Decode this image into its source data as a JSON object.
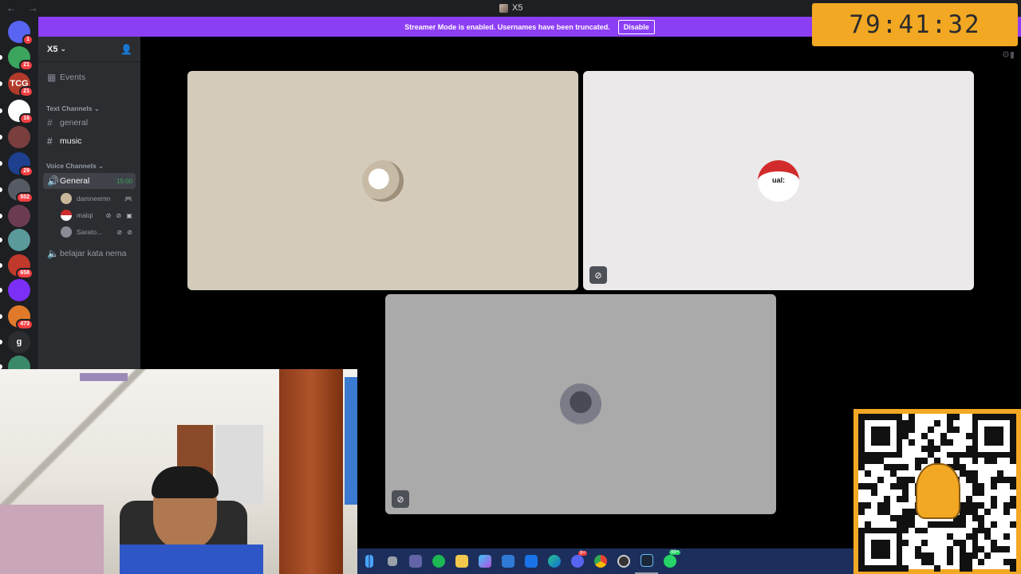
{
  "window": {
    "title": "X5",
    "nav": "← →"
  },
  "timer": "79:41:32",
  "streamer_banner": {
    "text": "Streamer Mode is enabled. Usernames have been truncated.",
    "button": "Disable"
  },
  "guilds": [
    {
      "label": "",
      "badge": "1",
      "color": "#5865f2"
    },
    {
      "label": "",
      "badge": "21",
      "color": "#3ba55d"
    },
    {
      "label": "TCG",
      "badge": "21",
      "color": "#b23a2a"
    },
    {
      "label": "",
      "badge": "16",
      "color": "#ffffff"
    },
    {
      "label": "",
      "badge": "",
      "color": "#7a3e3e"
    },
    {
      "label": "",
      "badge": "29",
      "color": "#1f3f8f"
    },
    {
      "label": "",
      "badge": "552",
      "color": "#555a63"
    },
    {
      "label": "",
      "badge": "",
      "color": "#6b3b52"
    },
    {
      "label": "",
      "badge": "",
      "color": "#5a9a9a"
    },
    {
      "label": "",
      "badge": "658",
      "color": "#c0392b"
    },
    {
      "label": "",
      "badge": "",
      "color": "#7b2ff7"
    },
    {
      "label": "",
      "badge": "473",
      "color": "#e07a2a"
    },
    {
      "label": "g",
      "badge": "",
      "color": "#2b2d31"
    },
    {
      "label": "",
      "badge": "",
      "color": "#3a8a6a"
    }
  ],
  "server": {
    "name": "X5"
  },
  "channels": {
    "events": "Events",
    "text_category": "Text Channels",
    "text": [
      "general",
      "music"
    ],
    "voice_category": "Voice Channels",
    "voice_general": {
      "name": "General",
      "time": "15:00"
    },
    "voice_users": [
      {
        "name": "damneemn",
        "icons": "🎮",
        "color": "#c8b79a"
      },
      {
        "name": "malqi",
        "icons": "⊘ ⊘ ▣",
        "color": "#d22b2b"
      },
      {
        "name": "Sarato...",
        "icons": "⊘ ⊘",
        "color": "#8a8a95"
      }
    ],
    "voice_other": "belajar kata nema"
  },
  "tiles": {
    "tile1_color": "#d4cbbb",
    "tile2_color": "#ebe9ea",
    "tile3_color": "#aaaaaa",
    "avatar2_text": "ual:"
  },
  "taskbar": {
    "icons": [
      "windows-icon",
      "files-icon",
      "teams-icon",
      "spotify-icon",
      "folder-icon",
      "copilot-icon",
      "store-icon",
      "mail-icon",
      "edge-icon",
      "discord-icon",
      "chrome-icon",
      "obs-icon",
      "steam-icon",
      "whatsapp-icon"
    ],
    "discord_badge": "9+",
    "whatsapp_badge": "99+"
  }
}
